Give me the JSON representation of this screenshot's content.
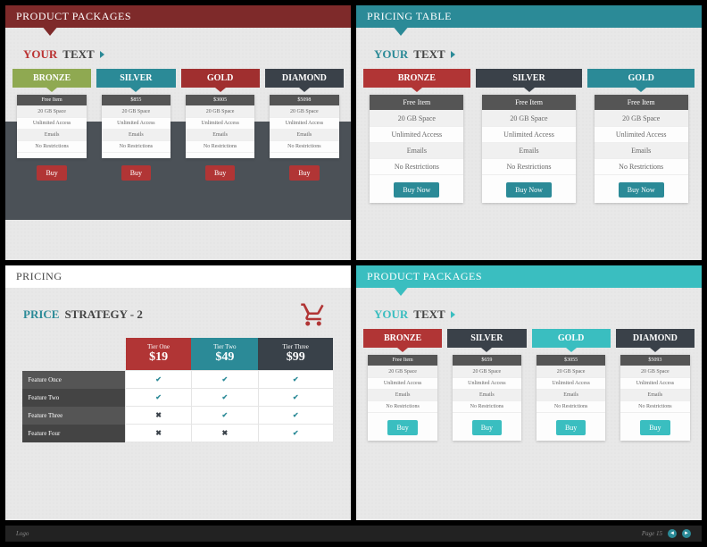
{
  "panels": {
    "p1": {
      "title": "PRODUCT PACKAGES",
      "subtitle_accent": "YOUR",
      "subtitle_rest": "TEXT",
      "tiers": [
        {
          "name": "BRONZE",
          "head": "Free Item",
          "f": [
            "20 GB Space",
            "Unlimited Access",
            "Emails",
            "No Restrictions"
          ],
          "btn": "Buy"
        },
        {
          "name": "SILVER",
          "head": "$855",
          "f": [
            "20 GB Space",
            "Unlimited Access",
            "Emails",
            "No Restrictions"
          ],
          "btn": "Buy"
        },
        {
          "name": "GOLD",
          "head": "$3005",
          "f": [
            "20 GB Space",
            "Unlimited Access",
            "Emails",
            "No Restrictions"
          ],
          "btn": "Buy"
        },
        {
          "name": "DIAMOND",
          "head": "$5098",
          "f": [
            "20 GB Space",
            "Unlimited Access",
            "Emails",
            "No Restrictions"
          ],
          "btn": "Buy"
        }
      ]
    },
    "p2": {
      "title": "PRICING TABLE",
      "subtitle_accent": "YOUR",
      "subtitle_rest": "TEXT",
      "tiers": [
        {
          "name": "BRONZE",
          "head": "Free Item",
          "f": [
            "20 GB Space",
            "Unlimited Access",
            "Emails",
            "No Restrictions"
          ],
          "btn": "Buy Now"
        },
        {
          "name": "SILVER",
          "head": "Free Item",
          "f": [
            "20 GB Space",
            "Unlimited Access",
            "Emails",
            "No Restrictions"
          ],
          "btn": "Buy Now"
        },
        {
          "name": "GOLD",
          "head": "Free Item",
          "f": [
            "20 GB Space",
            "Unlimited Access",
            "Emails",
            "No Restrictions"
          ],
          "btn": "Buy Now"
        }
      ]
    },
    "p3": {
      "title": "PRICING",
      "subtitle_accent": "PRICE",
      "subtitle_rest": "STRATEGY - 2",
      "cols": [
        {
          "name": "Tier One",
          "price": "$19"
        },
        {
          "name": "Tier Two",
          "price": "$49"
        },
        {
          "name": "Tier Three",
          "price": "$99"
        }
      ],
      "rows": [
        {
          "label": "Feature Once",
          "v": [
            "check",
            "check",
            "check"
          ]
        },
        {
          "label": "Feature Two",
          "v": [
            "check",
            "check",
            "check"
          ]
        },
        {
          "label": "Feature Three",
          "v": [
            "cross",
            "check",
            "check"
          ]
        },
        {
          "label": "Feature Four",
          "v": [
            "cross",
            "cross",
            "check"
          ]
        }
      ]
    },
    "p4": {
      "title": "PRODUCT PACKAGES",
      "subtitle_accent": "YOUR",
      "subtitle_rest": "TEXT",
      "tiers": [
        {
          "name": "BRONZE",
          "head": "Free Item",
          "f": [
            "20 GB Space",
            "Unlimited Access",
            "Emails",
            "No Restrictions"
          ],
          "btn": "Buy"
        },
        {
          "name": "SILVER",
          "head": "$659",
          "f": [
            "20 GB Space",
            "Unlimited Access",
            "Emails",
            "No Restrictions"
          ],
          "btn": "Buy"
        },
        {
          "name": "GOLD",
          "head": "$3055",
          "f": [
            "20 GB Space",
            "Unlimited Access",
            "Emails",
            "No Restrictions"
          ],
          "btn": "Buy"
        },
        {
          "name": "DIAMOND",
          "head": "$5093",
          "f": [
            "20 GB Space",
            "Unlimited Access",
            "Emails",
            "No Restrictions"
          ],
          "btn": "Buy"
        }
      ]
    }
  },
  "footer": {
    "logo": "Logo",
    "page": "Page 15"
  }
}
